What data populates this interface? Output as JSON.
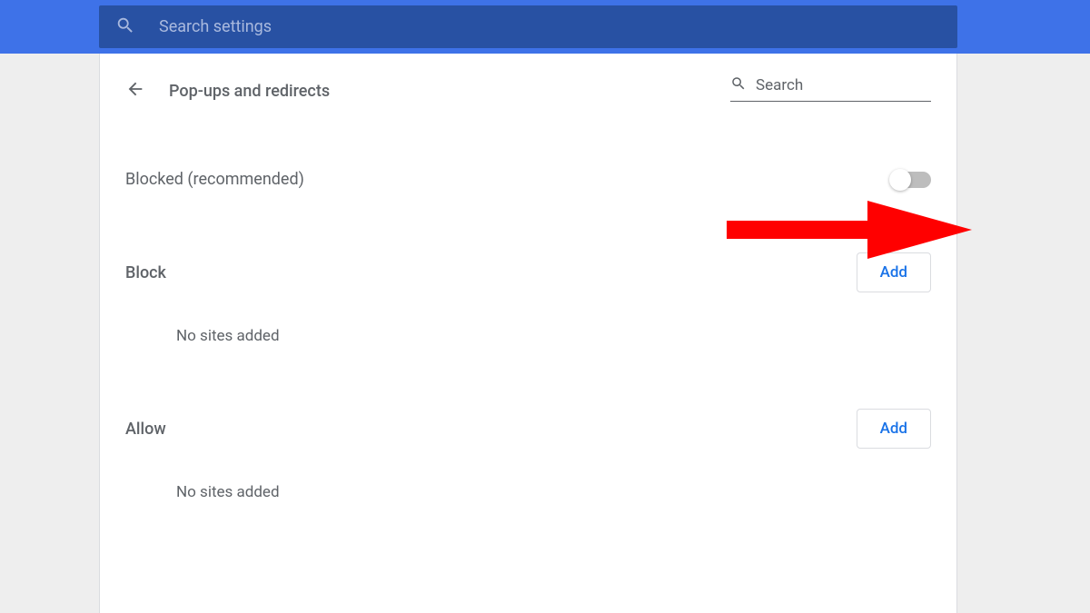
{
  "header": {
    "search_placeholder": "Search settings"
  },
  "panel": {
    "title": "Pop-ups and redirects",
    "search_placeholder": "Search"
  },
  "toggle": {
    "label": "Blocked (recommended)",
    "state": "off"
  },
  "sections": {
    "block": {
      "title": "Block",
      "add_label": "Add",
      "empty": "No sites added"
    },
    "allow": {
      "title": "Allow",
      "add_label": "Add",
      "empty": "No sites added"
    }
  },
  "annotation": {
    "type": "arrow",
    "color": "#ff0000",
    "points_to": "blocked-toggle"
  }
}
